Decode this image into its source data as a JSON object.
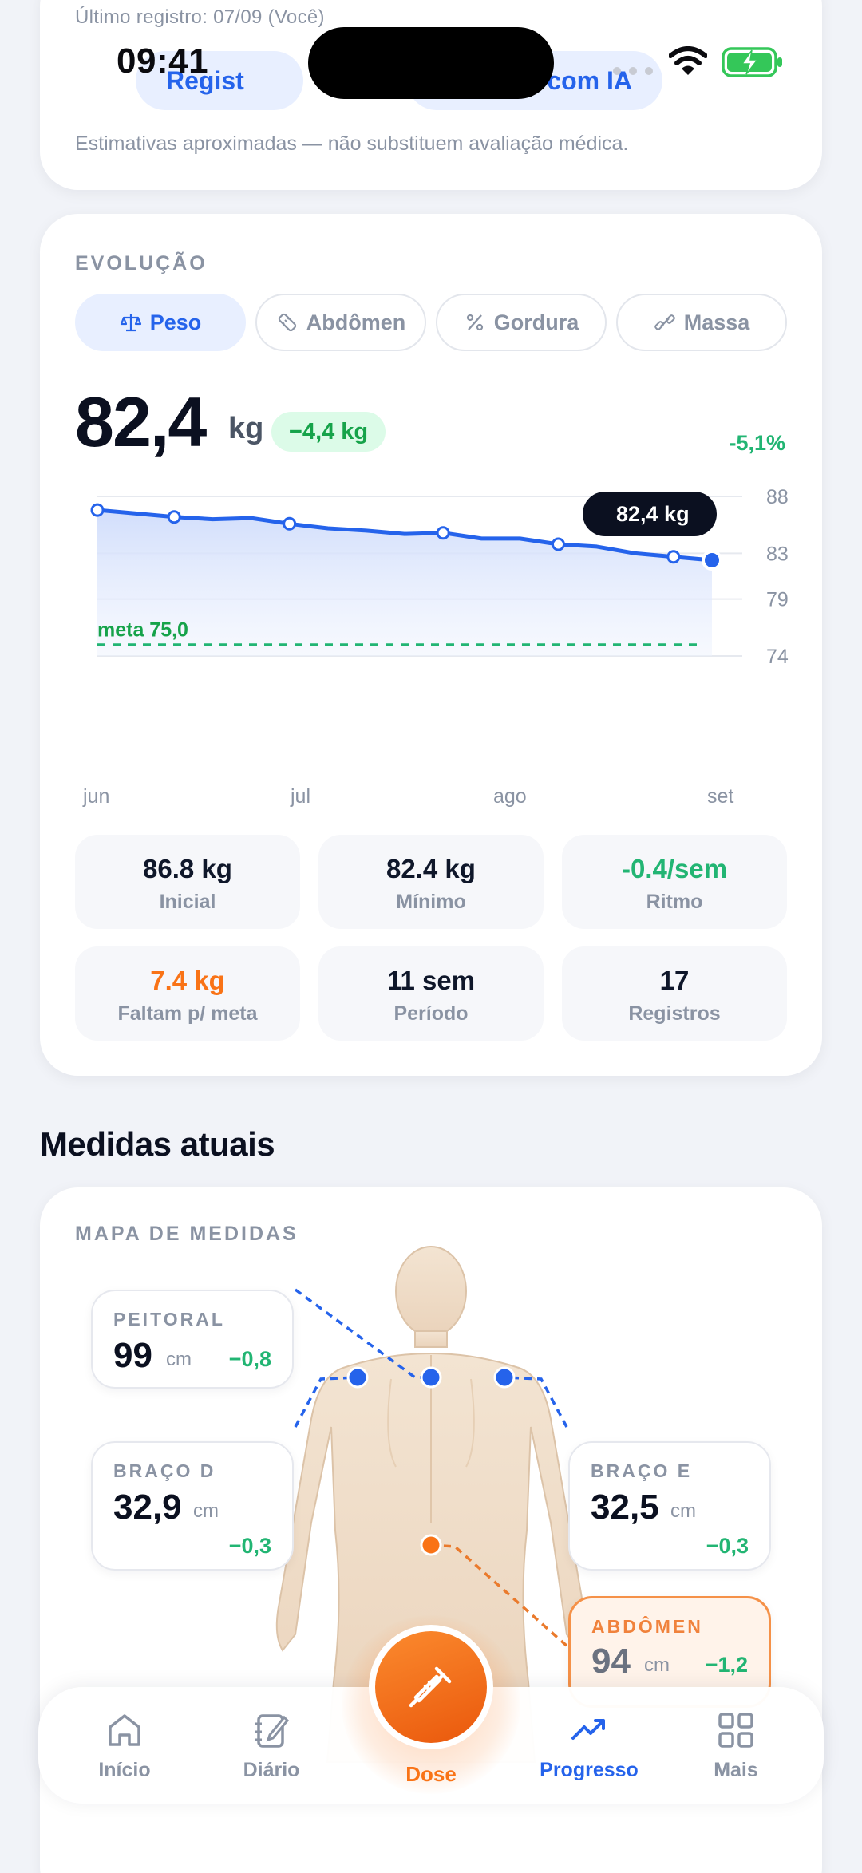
{
  "status_bar": {
    "time": "09:41"
  },
  "top_card": {
    "last_record": "Último registro: 07/09 (Você)",
    "buttons": [
      "Regist",
      "com IA"
    ],
    "disclaimer": "Estimativas aproximadas — não substituem avaliação médica."
  },
  "evolution": {
    "section_label": "EVOLUÇÃO",
    "tabs": [
      {
        "label": "Peso",
        "icon": "scale-icon",
        "active": true
      },
      {
        "label": "Abdômen",
        "icon": "tape-measure-icon",
        "active": false
      },
      {
        "label": "Gordura",
        "icon": "percent-icon",
        "active": false
      },
      {
        "label": "Massa",
        "icon": "dumbbell-icon",
        "active": false
      }
    ],
    "value": "82,4",
    "unit": "kg",
    "delta": "−4,4 kg",
    "delta_pct": "-5,1%",
    "month_labels": [
      "jun",
      "jul",
      "ago",
      "set"
    ],
    "stats": [
      {
        "value": "86.8 kg",
        "label": "Inicial",
        "color": "#0f172a"
      },
      {
        "value": "82.4 kg",
        "label": "Mínimo",
        "color": "#0f172a"
      },
      {
        "value": "-0.4/sem",
        "label": "Ritmo",
        "color": "#22b573"
      },
      {
        "value": "7.4 kg",
        "label": "Faltam p/ meta",
        "color": "#f97316"
      },
      {
        "value": "11 sem",
        "label": "Período",
        "color": "#0f172a"
      },
      {
        "value": "17",
        "label": "Registros",
        "color": "#0f172a"
      }
    ]
  },
  "chart_data": {
    "type": "area",
    "x": [
      "jun",
      "",
      "",
      "jul",
      "",
      "",
      "",
      "ago",
      "",
      "",
      "",
      "",
      "",
      "",
      "",
      "",
      "set"
    ],
    "series": [
      {
        "values": [
          86.8,
          86.5,
          86.2,
          86.0,
          86.1,
          85.6,
          85.2,
          85.0,
          84.7,
          84.8,
          84.3,
          84.3,
          83.8,
          83.6,
          83.0,
          82.7,
          82.4
        ]
      }
    ],
    "marked_points": [
      0,
      2,
      5,
      9,
      12,
      15
    ],
    "current_point": 16,
    "tooltip": "82,4  kg",
    "goal": {
      "value": 75.0,
      "label": "meta 75,0"
    },
    "y_ticks": [
      88,
      83,
      79,
      74
    ],
    "ylim": [
      74,
      88
    ],
    "grid": true,
    "colors": {
      "line": "#2563eb",
      "goal": "#22b573"
    }
  },
  "measures": {
    "heading": "Medidas atuais",
    "section_label": "MAPA DE MEDIDAS",
    "items": [
      {
        "label": "PEITORAL",
        "value": "99",
        "unit": "cm",
        "delta": "−0,8"
      },
      {
        "label": "BRAÇO D",
        "value": "32,9",
        "unit": "cm",
        "delta": "−0,3"
      },
      {
        "label": "BRAÇO E",
        "value": "32,5",
        "unit": "cm",
        "delta": "−0,3"
      },
      {
        "label": "ABDÔMEN",
        "value": "94",
        "unit": "cm",
        "delta": "−1,2",
        "highlight": true
      }
    ]
  },
  "nav": {
    "items": [
      {
        "label": "Início",
        "icon": "home-icon"
      },
      {
        "label": "Diário",
        "icon": "notebook-icon"
      },
      {
        "label": "Dose",
        "icon": "syringe-icon"
      },
      {
        "label": "Progresso",
        "icon": "trending-up-icon",
        "active": true
      },
      {
        "label": "Mais",
        "icon": "grid-icon"
      }
    ]
  },
  "colors": {
    "accent": "#2563eb",
    "success": "#22b573",
    "warning": "#f97316"
  }
}
